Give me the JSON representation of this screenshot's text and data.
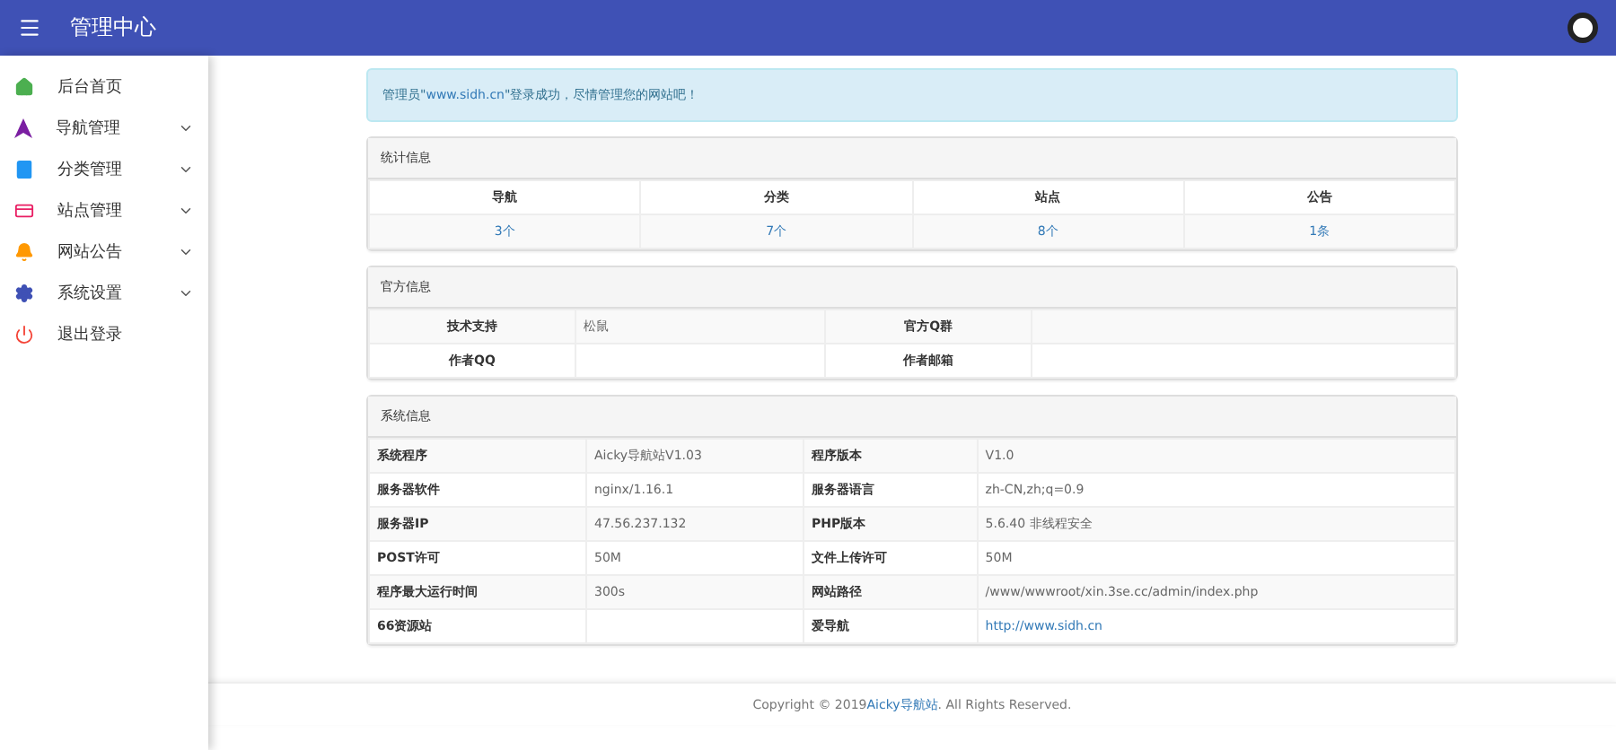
{
  "header": {
    "title": "管理中心"
  },
  "sidebar": {
    "items": [
      {
        "kind": "home",
        "label": "后台首页",
        "expandable": false
      },
      {
        "kind": "nav",
        "label": "导航管理",
        "expandable": true
      },
      {
        "kind": "category",
        "label": "分类管理",
        "expandable": true
      },
      {
        "kind": "site",
        "label": "站点管理",
        "expandable": true
      },
      {
        "kind": "notice",
        "label": "网站公告",
        "expandable": true
      },
      {
        "kind": "settings",
        "label": "系统设置",
        "expandable": true
      },
      {
        "kind": "logout",
        "label": "退出登录",
        "expandable": false
      }
    ]
  },
  "alert": {
    "before": "管理员\"",
    "link": "www.sidh.cn",
    "after": "\"登录成功，尽情管理您的网站吧！"
  },
  "stats": {
    "title": "统计信息",
    "columns": [
      {
        "label": "导航",
        "value": "3个"
      },
      {
        "label": "分类",
        "value": "7个"
      },
      {
        "label": "站点",
        "value": "8个"
      },
      {
        "label": "公告",
        "value": "1条"
      }
    ]
  },
  "official": {
    "title": "官方信息",
    "rows": [
      [
        "技术支持",
        "松鼠",
        "官方Q群",
        ""
      ],
      [
        "作者QQ",
        "",
        "作者邮箱",
        ""
      ]
    ]
  },
  "system": {
    "title": "系统信息",
    "rows": [
      {
        "k1": "系统程序",
        "v1": "Aicky导航站V1.03",
        "k2": "程序版本",
        "v2": "V1.0",
        "link": false
      },
      {
        "k1": "服务器软件",
        "v1": "nginx/1.16.1",
        "k2": "服务器语言",
        "v2": "zh-CN,zh;q=0.9",
        "link": false
      },
      {
        "k1": "服务器IP",
        "v1": "47.56.237.132",
        "k2": "PHP版本",
        "v2": "5.6.40 非线程安全",
        "link": false
      },
      {
        "k1": "POST许可",
        "v1": "50M",
        "k2": "文件上传许可",
        "v2": "50M",
        "link": false
      },
      {
        "k1": "程序最大运行时间",
        "v1": "300s",
        "k2": "网站路径",
        "v2": "/www/wwwroot/xin.3se.cc/admin/index.php",
        "link": false
      },
      {
        "k1": "66资源站",
        "v1": "",
        "k2": "爱导航",
        "v2": "http://www.sidh.cn",
        "link": true
      }
    ]
  },
  "footer": {
    "before": "Copyright © 2019 ",
    "link": "Aicky导航站",
    "after": ". All Rights Reserved."
  }
}
